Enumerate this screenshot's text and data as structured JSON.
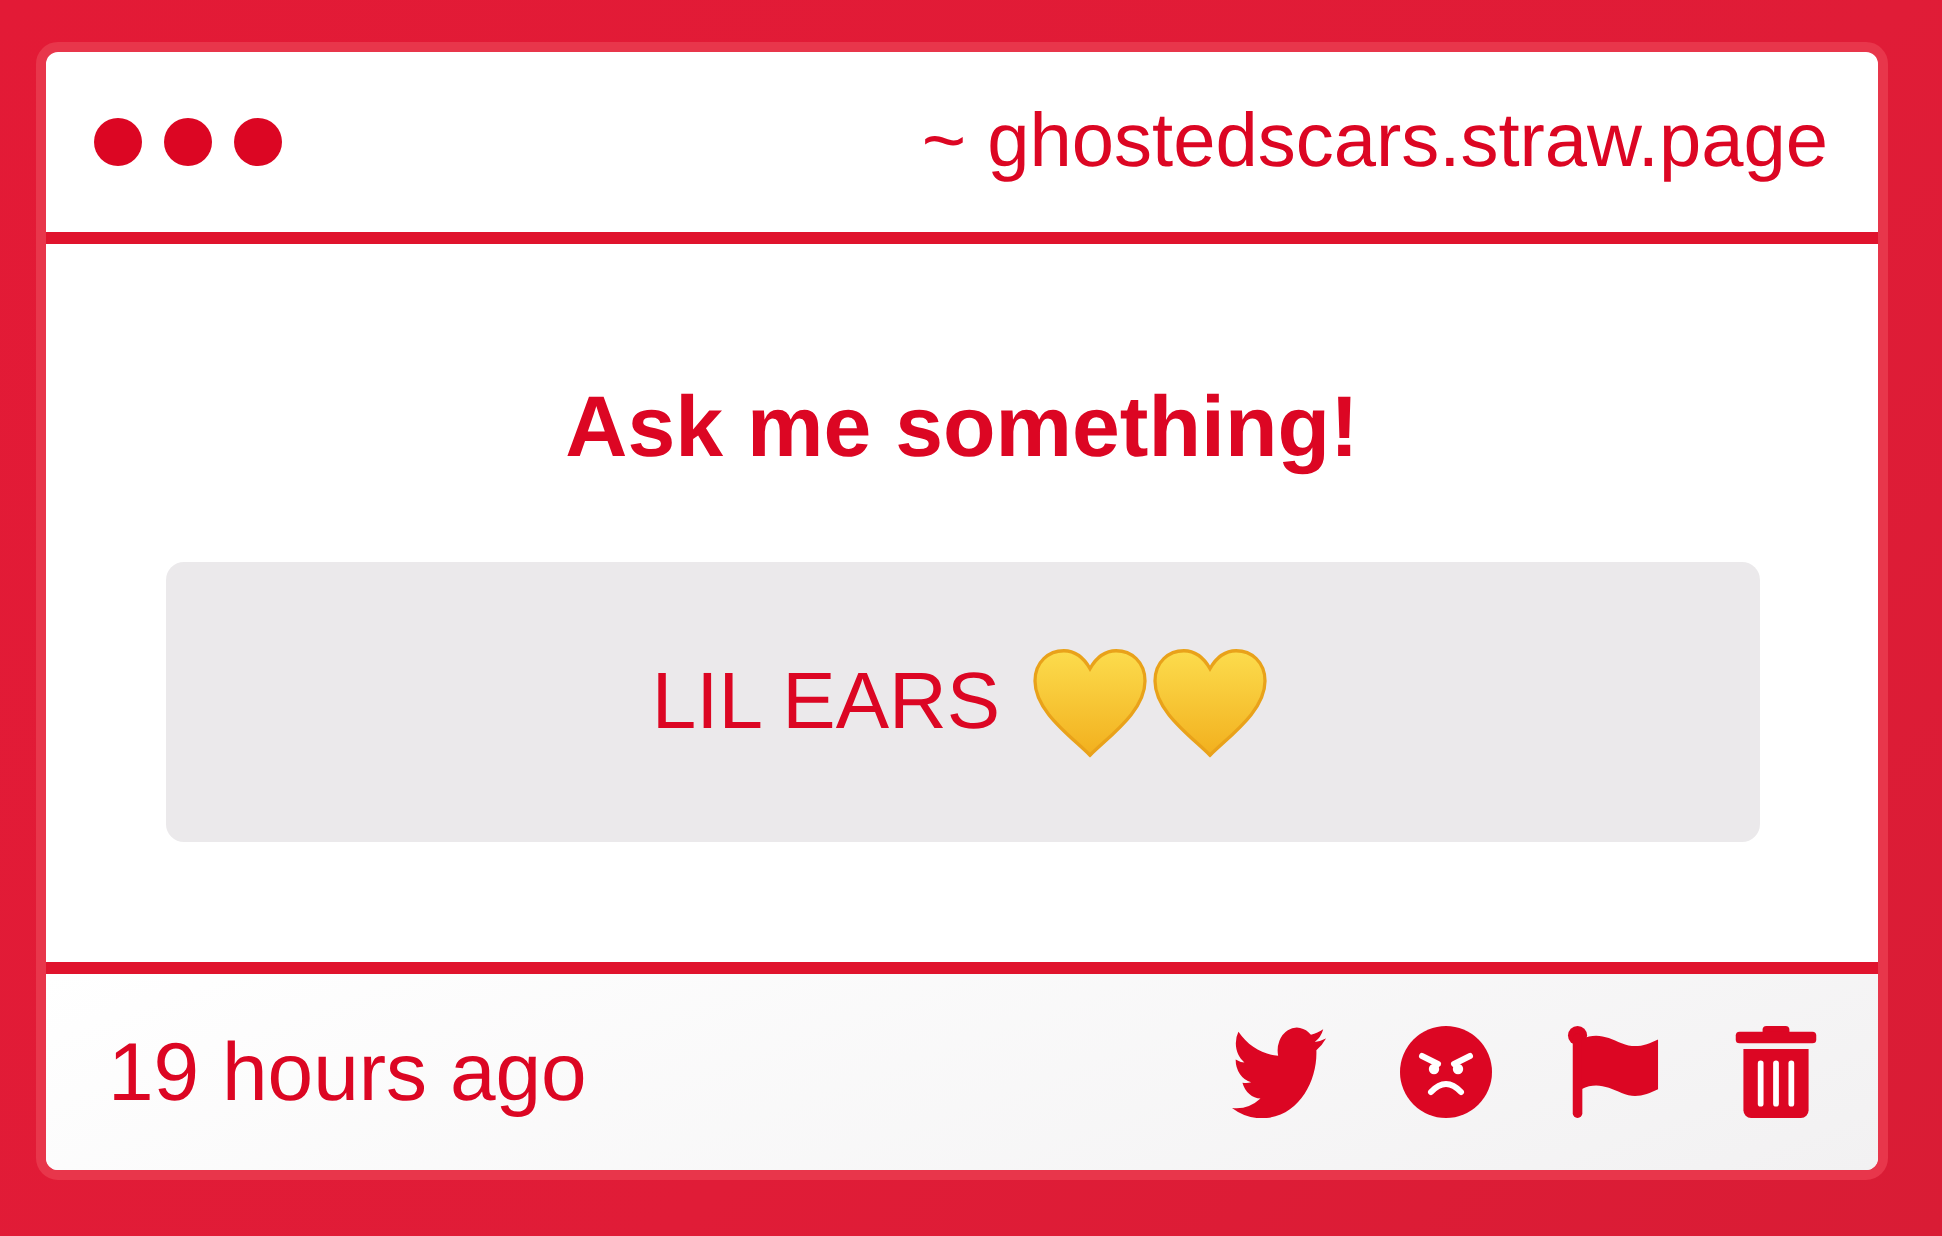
{
  "window": {
    "address": "~ ghostedscars.straw.page"
  },
  "prompt": {
    "title": "Ask me something!"
  },
  "question": {
    "text": "LIL EARS",
    "emoji": [
      {
        "kind": "heart"
      },
      {
        "kind": "heart"
      }
    ]
  },
  "footer": {
    "time": "19 hours ago",
    "actions": [
      {
        "kind": "bird"
      },
      {
        "kind": "angry"
      },
      {
        "kind": "flag"
      },
      {
        "kind": "trash"
      }
    ]
  }
}
